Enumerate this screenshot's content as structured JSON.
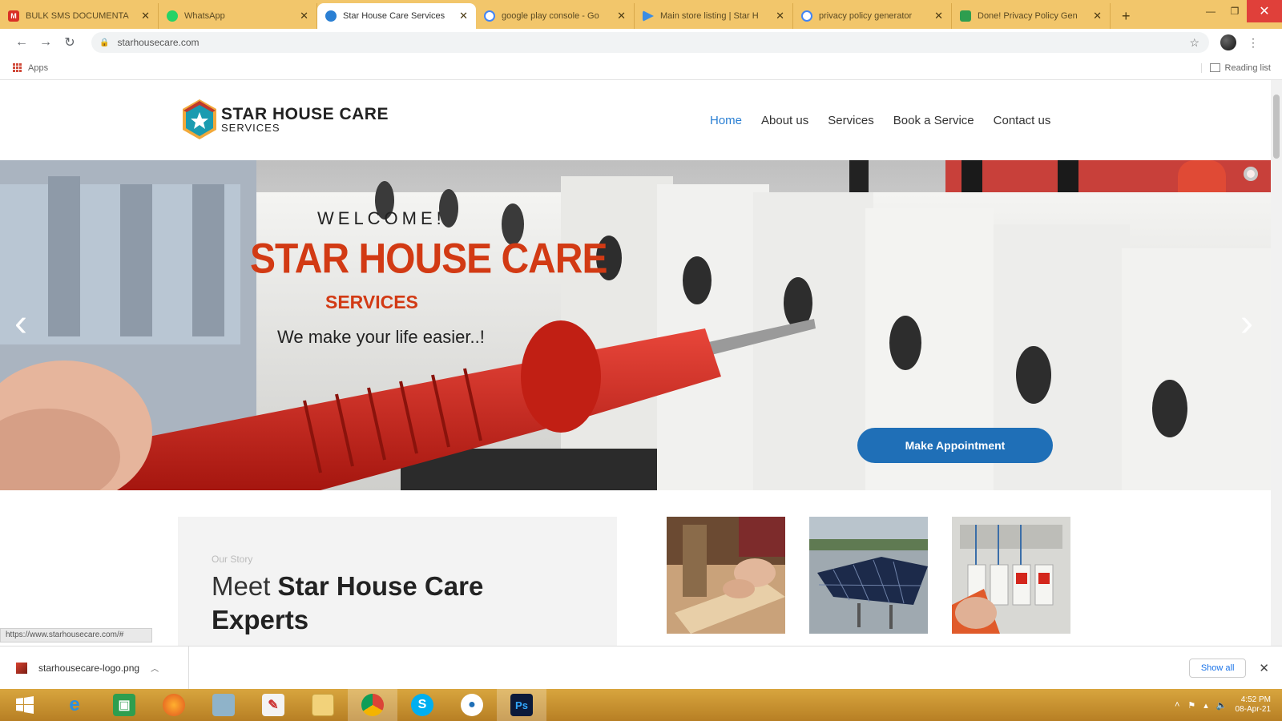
{
  "browser": {
    "tabs": [
      {
        "title": "BULK SMS DOCUMENTA",
        "icon": "gmail-icon",
        "color": "#d93025"
      },
      {
        "title": "WhatsApp",
        "icon": "whatsapp-icon",
        "color": "#25d366"
      },
      {
        "title": "Star House Care Services",
        "icon": "site-icon",
        "color": "#2a7fd3",
        "active": true
      },
      {
        "title": "google play console - Go",
        "icon": "google-icon",
        "color": "#4285f4"
      },
      {
        "title": "Main store listing | Star H",
        "icon": "play-console-icon",
        "color": "#3c8de3"
      },
      {
        "title": "privacy policy generator",
        "icon": "google-icon",
        "color": "#4285f4"
      },
      {
        "title": "Done! Privacy Policy Gen",
        "icon": "doc-icon",
        "color": "#2e9e4f"
      }
    ],
    "new_tab": "+",
    "url": "starhousecare.com",
    "bookmarks": {
      "apps_label": "Apps",
      "reading_list": "Reading list"
    }
  },
  "site": {
    "logo": {
      "title": "STAR  HOUSE CARE",
      "subtitle": "SERVICES"
    },
    "nav": [
      "Home",
      "About us",
      "Services",
      "Book a Service",
      "Contact us"
    ],
    "hero": {
      "welcome": "WELCOME!",
      "brand": "STAR HOUSE CARE",
      "brand_sub": "SERVICES",
      "tagline": "We make your life easier..!",
      "cta": "Make Appointment"
    },
    "story": {
      "kicker": "Our Story",
      "heading_light": "Meet ",
      "heading_bold": "Star House Care Experts"
    }
  },
  "status_url": "https://www.starhousecare.com/#",
  "downloads": {
    "file": "starhousecare-logo.png",
    "show_all": "Show all"
  },
  "taskbar": {
    "time": "4:52 PM",
    "date": "08-Apr-21",
    "apps": [
      "start-icon",
      "ie-icon",
      "store-icon",
      "firefox-icon",
      "files-icon",
      "notepad-icon",
      "explorer-icon",
      "chrome-icon",
      "skype-icon",
      "app-icon",
      "photoshop-icon"
    ]
  },
  "colors": {
    "accent": "#2a7fd3",
    "brand_red": "#d23a14",
    "cta_blue": "#1f6fb7",
    "tabstrip": "#f2c66b"
  }
}
